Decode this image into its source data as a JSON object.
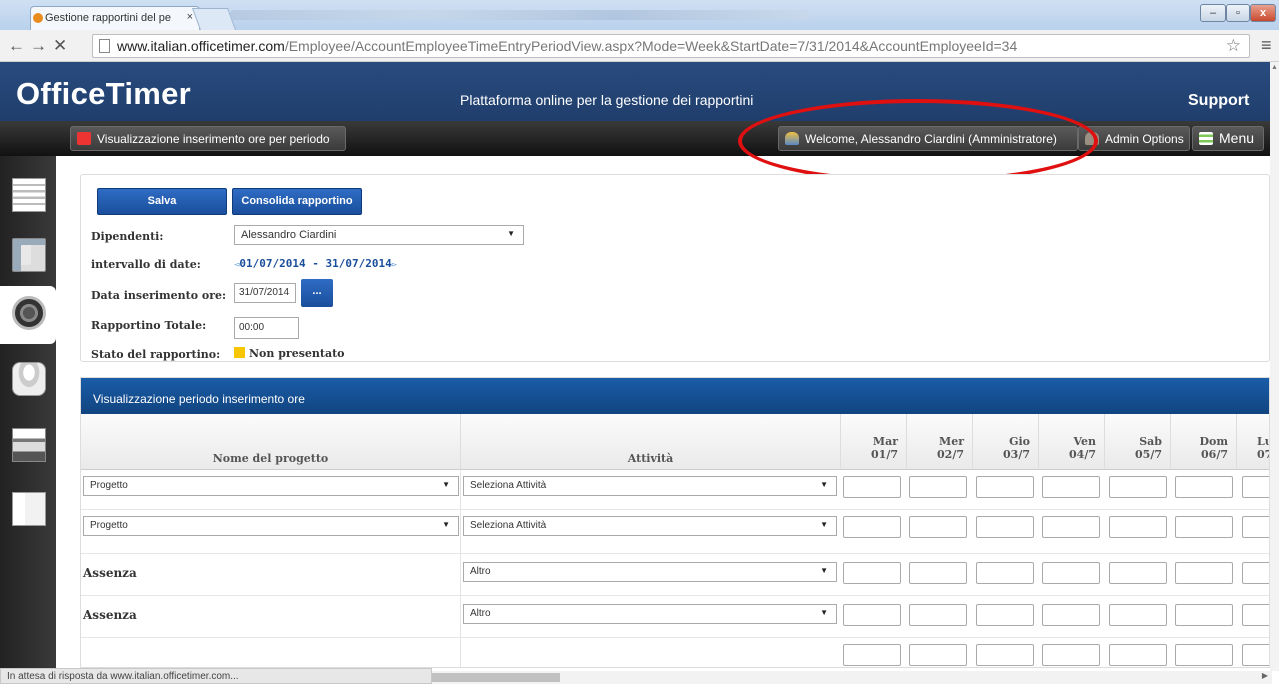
{
  "browser": {
    "tab_title": "Gestione rapportini del pe",
    "tab_close": "×",
    "url_host": "www.italian.officetimer.com",
    "url_path": "/Employee/AccountEmployeeTimeEntryPeriodView.aspx?Mode=Week&StartDate=7/31/2014&AccountEmployeeId=34",
    "status_text": "In attesa di risposta da www.italian.officetimer.com...",
    "back_glyph": "←",
    "forward_glyph": "→",
    "stop_glyph": "✕",
    "star_glyph": "☆",
    "menu_glyph": "≡",
    "win_min": "–",
    "win_max": "▫",
    "win_close": "x"
  },
  "header": {
    "logo": "OfficeTimer",
    "tagline": "Plattaforma online per la gestione dei rapportini",
    "support": "Support"
  },
  "nav": {
    "period_view": "Visualizzazione inserimento ore per periodo",
    "welcome": "Welcome, Alessandro Ciardini (Amministratore)",
    "admin_options": "Admin Options",
    "menu": "Menu"
  },
  "form": {
    "save": "Salva",
    "consolidate": "Consolida rapportino",
    "employee_label": "Dipendenti:",
    "employee_value": "Alessandro Ciardini",
    "range_label": "intervallo di date:",
    "range_value": "01/07/2014 - 31/07/2014",
    "entry_date_label": "Data inserimento ore:",
    "entry_date_value": "31/07/2014",
    "picker": "...",
    "total_label": "Rapportino Totale:",
    "total_value": "00:00",
    "status_label": "Stato del rapportino:",
    "status_value": "Non presentato"
  },
  "grid": {
    "title": "Visualizzazione periodo inserimento ore",
    "project_header": "Nome del progetto",
    "activity_header": "Attività",
    "days": [
      {
        "name": "Mar",
        "date": "01/7"
      },
      {
        "name": "Mer",
        "date": "02/7"
      },
      {
        "name": "Gio",
        "date": "03/7"
      },
      {
        "name": "Ven",
        "date": "04/7"
      },
      {
        "name": "Sab",
        "date": "05/7"
      },
      {
        "name": "Dom",
        "date": "06/7"
      },
      {
        "name": "Lu",
        "date": "07"
      }
    ],
    "rows": [
      {
        "project": "Progetto",
        "activity": "Seleziona Attività"
      },
      {
        "project": "Progetto",
        "activity": "Seleziona Attività"
      },
      {
        "label": "Assenza",
        "activity": "Altro"
      },
      {
        "label": "Assenza",
        "activity": "Altro"
      }
    ]
  },
  "colors": {
    "header_blue": "#284b7e",
    "button_blue": "#1a4f9c",
    "highlight_red": "#e01010",
    "status_yellow": "#f7c600"
  }
}
